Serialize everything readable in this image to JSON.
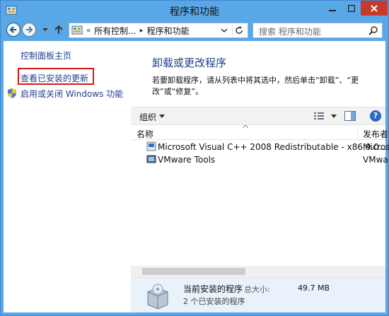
{
  "window": {
    "title": "程序和功能"
  },
  "address": {
    "overflow": "«",
    "crumbs": [
      "所有控制...",
      "程序和功能"
    ],
    "search_placeholder": "搜索 程序和功能"
  },
  "left_pane": {
    "home": "控制面板主页",
    "view_updates": "查看已安装的更新",
    "windows_features": "启用或关闭 Windows 功能"
  },
  "content": {
    "title": "卸载或更改程序",
    "description": "若要卸载程序，请从列表中将其选中，然后单击“卸载”、“更改”或“修复”。"
  },
  "toolbar": {
    "organize": "组织"
  },
  "list": {
    "columns": [
      "名称",
      "发布者"
    ],
    "rows": [
      {
        "name": "Microsoft Visual C++ 2008 Redistributable - x86 9.0....",
        "publisher": "Micros"
      },
      {
        "name": "VMware Tools",
        "publisher": "VMwa"
      }
    ]
  },
  "details": {
    "title": "当前安装的程序",
    "size_label": "总大小:",
    "size_value": "49.7 MB",
    "count": "2 个已安装的程序"
  }
}
